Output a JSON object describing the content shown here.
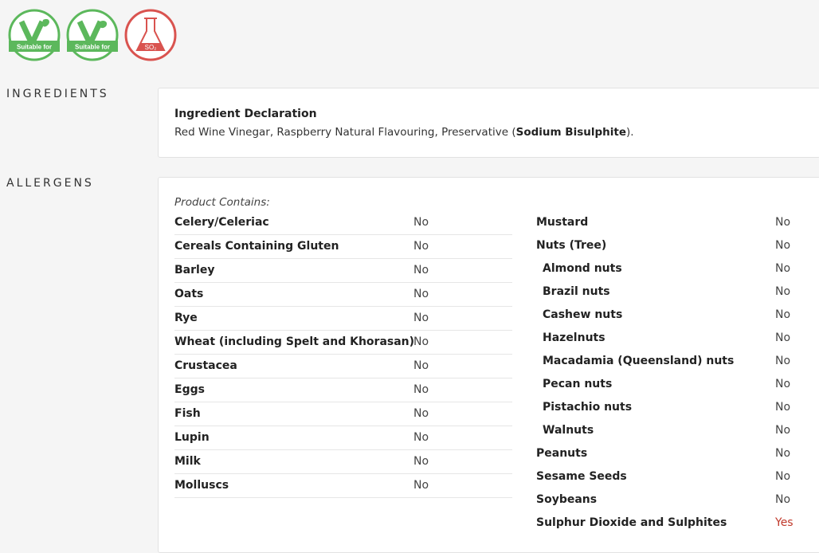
{
  "badges": [
    {
      "icon": "vegetarian-icon",
      "caption": "Suitable for",
      "color": "#5cb85c"
    },
    {
      "icon": "vegan-icon",
      "caption": "Suitable for",
      "color": "#5cb85c"
    },
    {
      "icon": "sulphites-flask-icon",
      "caption": "SO₂",
      "color": "#d9534f"
    }
  ],
  "sections": {
    "ingredients_label": "INGREDIENTS",
    "allergens_label": "ALLERGENS"
  },
  "ingredients": {
    "title": "Ingredient Declaration",
    "text_before": "Red Wine Vinegar, Raspberry Natural Flavouring, Preservative (",
    "text_bold": "Sodium Bisulphite",
    "text_after": ")."
  },
  "allergens": {
    "contains_label": "Product Contains:",
    "left": [
      {
        "name": "Celery/Celeriac",
        "value": "No"
      },
      {
        "name": "Cereals Containing Gluten",
        "value": "No"
      },
      {
        "name": "Barley",
        "value": "No"
      },
      {
        "name": "Oats",
        "value": "No"
      },
      {
        "name": "Rye",
        "value": "No"
      },
      {
        "name": "Wheat (including Spelt and Khorasan)",
        "value": "No"
      },
      {
        "name": "Crustacea",
        "value": "No"
      },
      {
        "name": "Eggs",
        "value": "No"
      },
      {
        "name": "Fish",
        "value": "No"
      },
      {
        "name": "Lupin",
        "value": "No"
      },
      {
        "name": "Milk",
        "value": "No"
      },
      {
        "name": "Molluscs",
        "value": "No"
      }
    ],
    "right": [
      {
        "name": "Mustard",
        "value": "No",
        "sub": false
      },
      {
        "name": "Nuts (Tree)",
        "value": "No",
        "sub": false
      },
      {
        "name": "Almond nuts",
        "value": "No",
        "sub": true
      },
      {
        "name": "Brazil nuts",
        "value": "No",
        "sub": true
      },
      {
        "name": "Cashew nuts",
        "value": "No",
        "sub": true
      },
      {
        "name": "Hazelnuts",
        "value": "No",
        "sub": true
      },
      {
        "name": "Macadamia (Queensland) nuts",
        "value": "No",
        "sub": true
      },
      {
        "name": "Pecan nuts",
        "value": "No",
        "sub": true
      },
      {
        "name": "Pistachio nuts",
        "value": "No",
        "sub": true
      },
      {
        "name": "Walnuts",
        "value": "No",
        "sub": true
      },
      {
        "name": "Peanuts",
        "value": "No",
        "sub": false
      },
      {
        "name": "Sesame Seeds",
        "value": "No",
        "sub": false
      },
      {
        "name": "Soybeans",
        "value": "No",
        "sub": false
      },
      {
        "name": "Sulphur Dioxide and Sulphites",
        "value": "Yes",
        "sub": false
      }
    ]
  }
}
